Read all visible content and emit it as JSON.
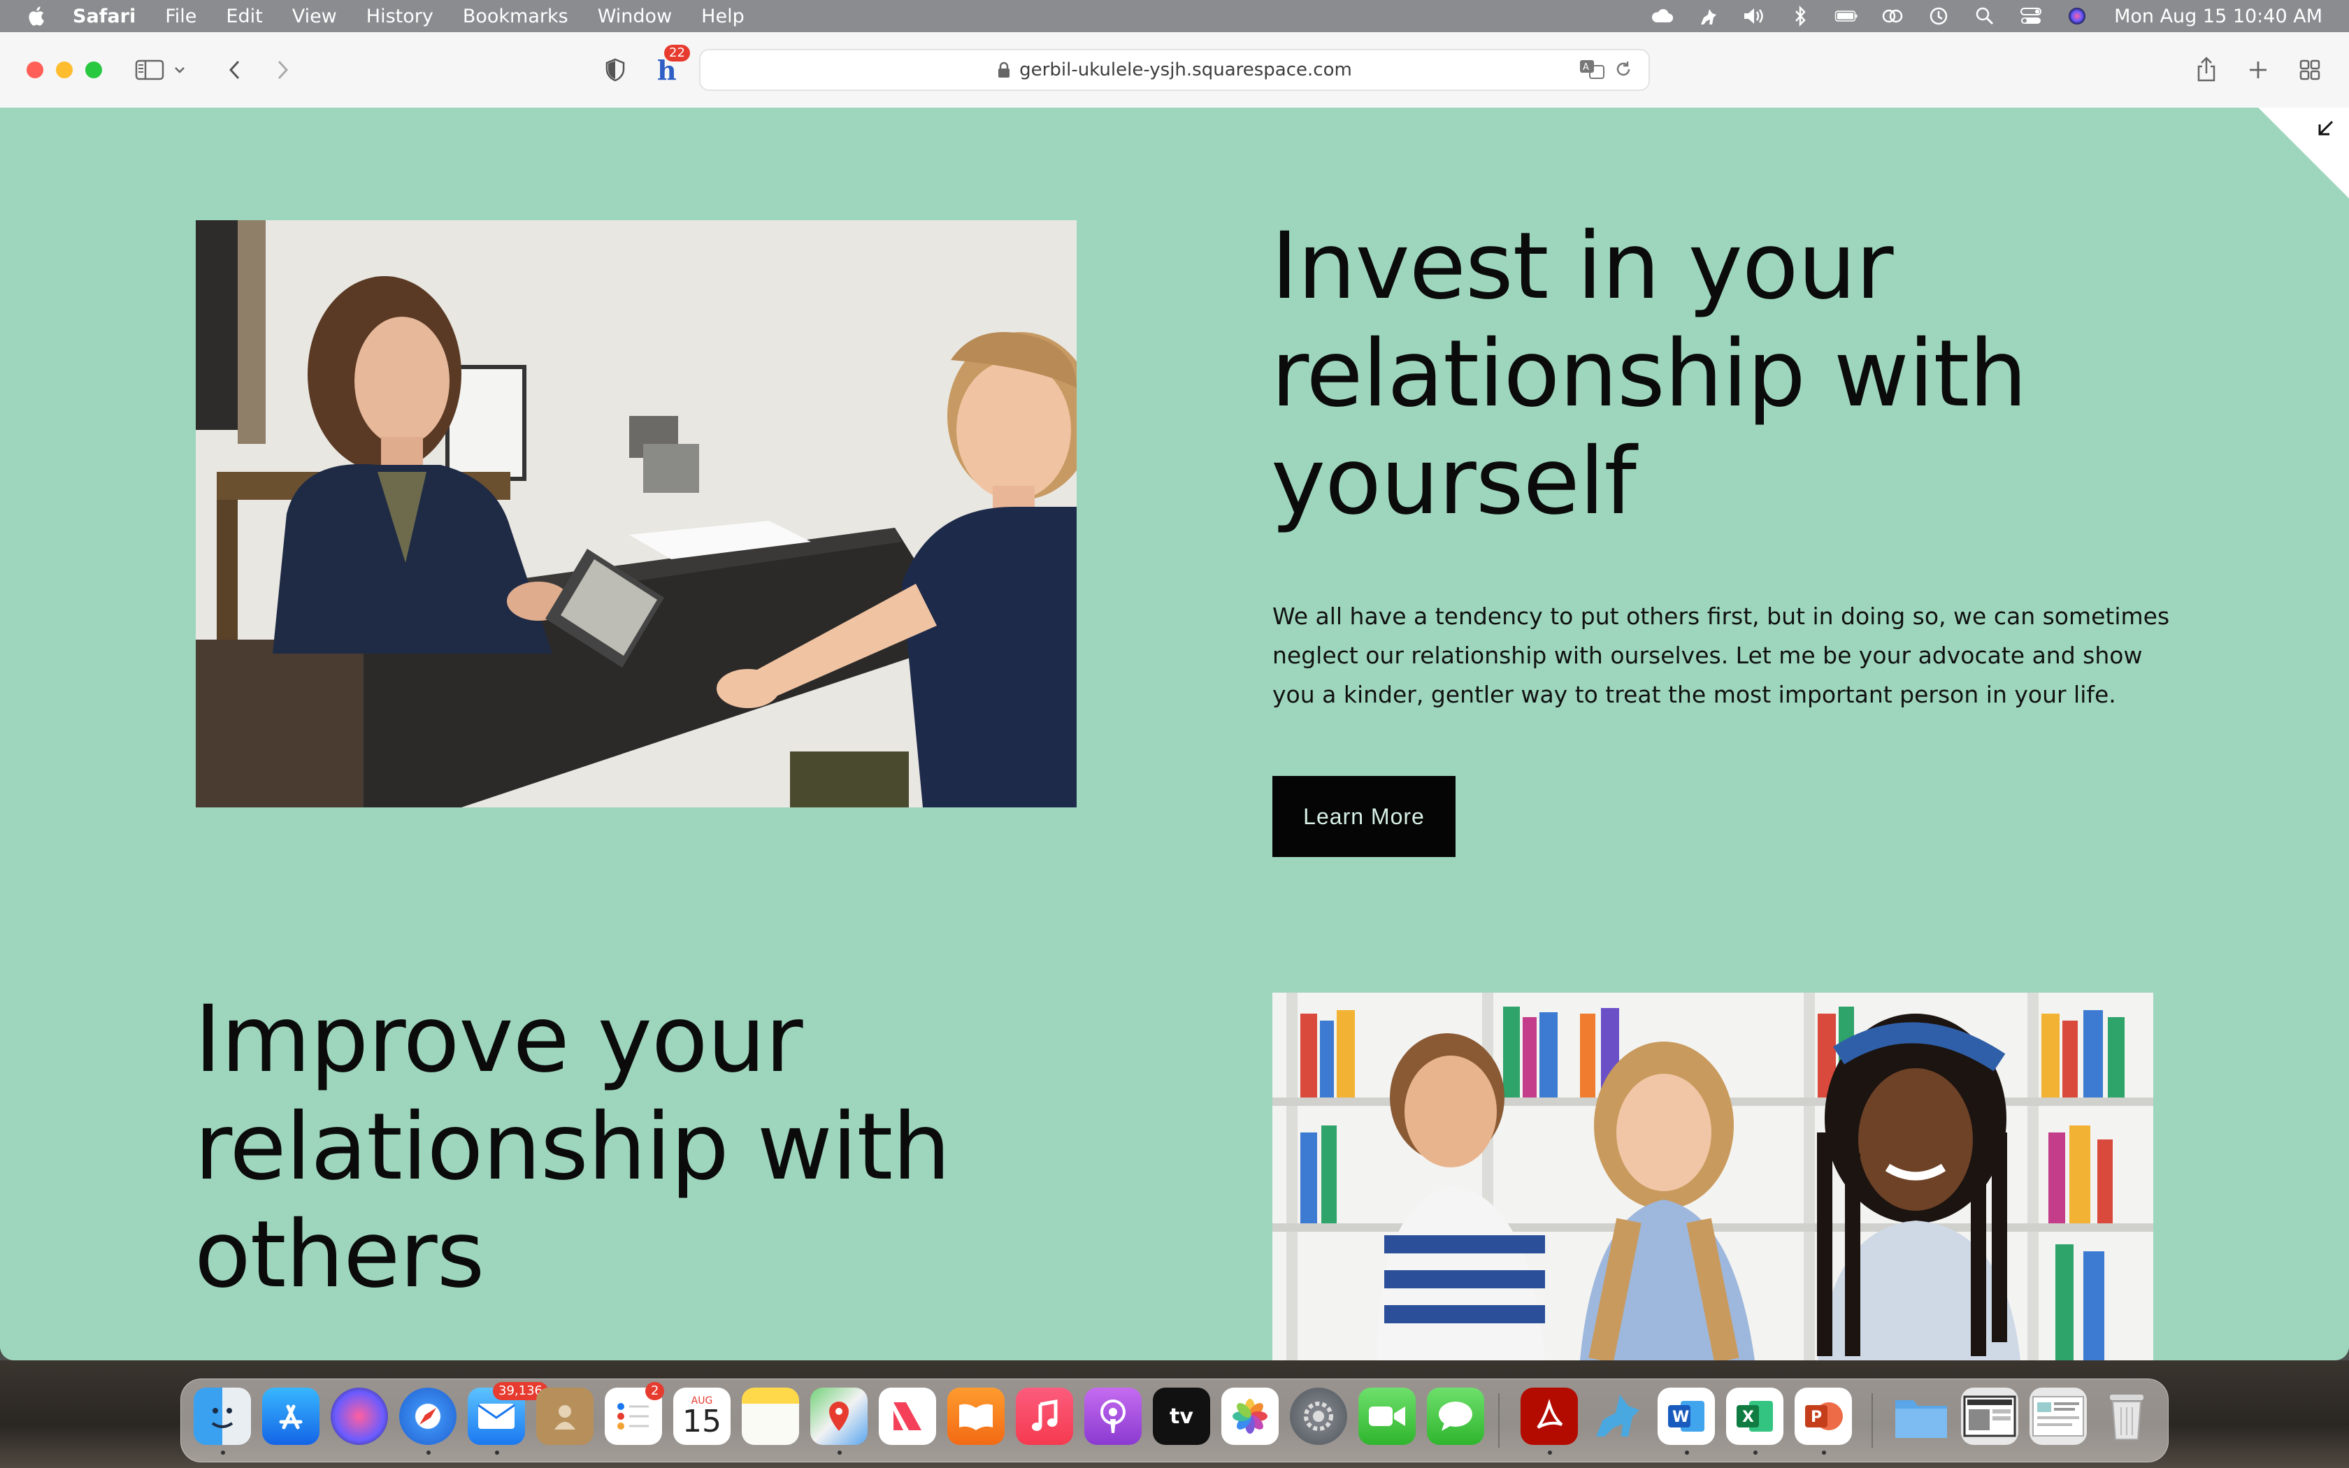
{
  "menubar": {
    "app_name": "Safari",
    "menus": [
      "File",
      "Edit",
      "View",
      "History",
      "Bookmarks",
      "Window",
      "Help"
    ],
    "clock": "Mon Aug 15  10:40 AM"
  },
  "toolbar": {
    "extension_badge": "22",
    "url": "gerbil-ukulele-ysjh.squarespace.com"
  },
  "page": {
    "section1": {
      "heading": "Invest in your relationship with yourself",
      "body": "We all have a tendency to put others first, but in doing so, we can sometimes neglect our relationship with ourselves. Let me be your advocate and show you a kinder, gentler way to treat the most important person in your life.",
      "button_label": "Learn More"
    },
    "section2": {
      "heading": "Improve your relationship with others"
    }
  },
  "dock": {
    "mail_badge": "39,136",
    "reminders_badge": "2",
    "calendar_month": "AUG",
    "calendar_day": "15",
    "appletv_label": "tv"
  },
  "colors": {
    "page_background": "#9dd6bd",
    "button_background": "#050505",
    "heading_text": "#0b0b0b"
  }
}
